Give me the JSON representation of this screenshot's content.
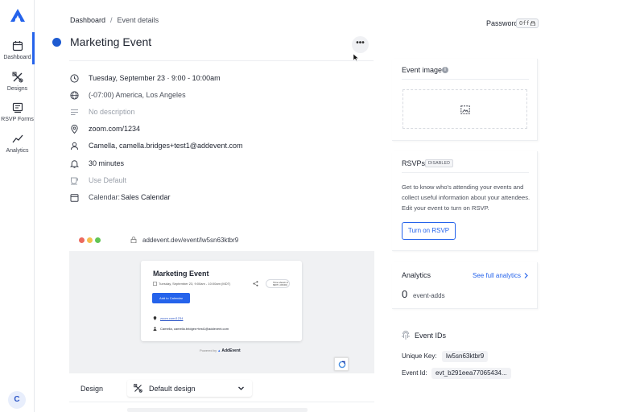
{
  "colors": {
    "accent": "#2563eb",
    "status_dot": "#1e5bd1"
  },
  "sidebar": {
    "logo": "addevent-logo",
    "items": [
      {
        "label": "Dashboard",
        "icon": "calendar-icon",
        "active": true
      },
      {
        "label": "Designs",
        "icon": "designs-icon",
        "active": false
      },
      {
        "label": "RSVP Forms",
        "icon": "rsvp-form-icon",
        "active": false
      },
      {
        "label": "Analytics",
        "icon": "analytics-icon",
        "active": false
      }
    ],
    "avatar_initial": "C"
  },
  "header": {
    "breadcrumb": {
      "root": "Dashboard",
      "separator": "/",
      "current": "Event details"
    },
    "password_label": "Password",
    "password_toggle": "Off"
  },
  "event": {
    "title": "Marketing Event",
    "details": [
      {
        "icon": "clock-icon",
        "text": "Tuesday, September 23 · 9:00 - 10:00am",
        "style": "normal"
      },
      {
        "icon": "globe-icon",
        "text": "(-07:00) America, Los Angeles",
        "style": "gray"
      },
      {
        "icon": "description-icon",
        "text": "No description",
        "style": "muted"
      },
      {
        "icon": "location-icon",
        "text": "zoom.com/1234",
        "style": "normal"
      },
      {
        "icon": "person-icon",
        "text": "Camella, camella.bridges+test1@addevent.com",
        "style": "normal"
      },
      {
        "icon": "bell-icon",
        "text": "30 minutes",
        "style": "normal"
      },
      {
        "icon": "cup-icon",
        "text": "Use Default",
        "style": "muted"
      }
    ],
    "calendar_label": "Calendar:",
    "calendar_value": "Sales Calendar"
  },
  "preview": {
    "url": "addevent.dev/event/lw5sn63ktbr9",
    "card_title": "Marketing Event",
    "card_date": "Tuesday, September 23, 9:00am - 10:00am (MDT)",
    "card_button": "Add to Calendar",
    "card_location": "zoom.com/1234",
    "card_person": "Camella, camella.bridges+test1@addevent.com",
    "card_tz": "Time shown in MDT (-06:00)",
    "powered_by": "Powered by",
    "powered_brand": "AddEvent"
  },
  "design": {
    "label": "Design",
    "selected": "Default design"
  },
  "panels": {
    "image": {
      "title": "Event image"
    },
    "rsvp": {
      "title": "RSVPs",
      "badge": "DISABLED",
      "description": "Get to know who's attending your events and collect useful information about your attendees. Edit your event to turn on RSVP.",
      "button": "Turn on RSVP"
    },
    "analytics": {
      "title": "Analytics",
      "link": "See full analytics",
      "count": "0",
      "count_label": "event-adds"
    },
    "ids": {
      "title": "Event IDs",
      "unique_key_label": "Unique Key:",
      "unique_key": "lw5sn63ktbr9",
      "event_id_label": "Event Id:",
      "event_id": "evt_b291eea77065434..."
    }
  }
}
